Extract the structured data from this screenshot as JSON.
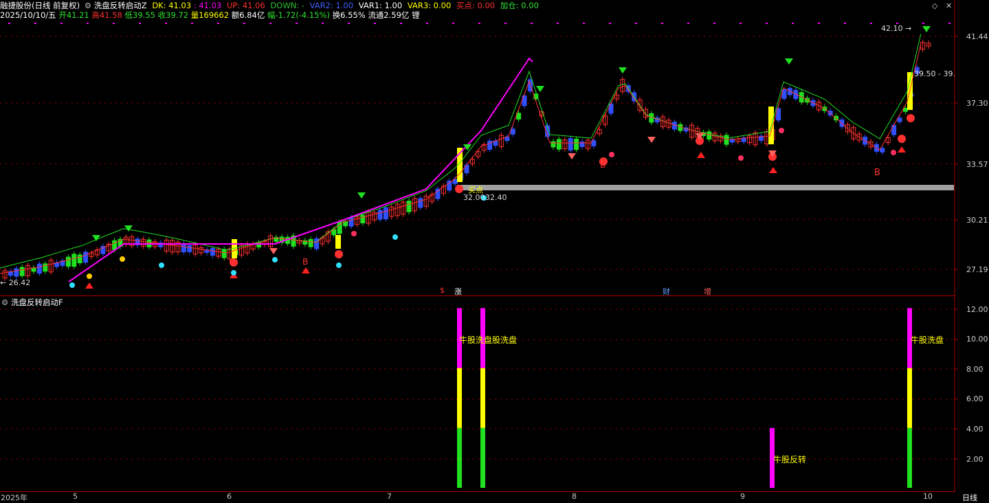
{
  "header": {
    "stock": "融捷股份(日线 前复权)",
    "indicator": "洗盘反转启动Z",
    "dk": "DK: 41.03",
    "dk2": ": 41.03",
    "up": "UP: 41.06",
    "down": "DOWN: -",
    "var2": "VAR2: 1.00",
    "var1": "VAR1: 1.00",
    "var3": "VAR3: 0.00",
    "buy": "买点: 0.00",
    "add": "加仓: 0.00"
  },
  "quote": {
    "date": "2025/10/10/五",
    "open": "开41.21",
    "high": "高41.58",
    "low": "低39.55",
    "close": "收39.72",
    "vol": "量169662",
    "amount": "额6.84亿",
    "change": "幅-1.72(-4.15%)",
    "turnover": "换6.55%",
    "float": "流通2.59亿",
    "extra": "锂"
  },
  "main_axis": {
    "ticks": [
      "41.44",
      "37.30",
      "33.57",
      "30.21",
      "27.19"
    ]
  },
  "indicator_axis": {
    "title": "洗盘反转启动F",
    "ticks": [
      "12.00",
      "10.00",
      "8.00",
      "6.00",
      "4.00",
      "2.00"
    ]
  },
  "bottom_axis": {
    "labels": [
      "2025年",
      "5",
      "6",
      "7",
      "8",
      "9",
      "10"
    ],
    "period": "日线"
  },
  "annotations": {
    "low_mark": "26.42",
    "high_mark": "42.10",
    "range_mark": "39.50 - 39.",
    "buy_label": "买点",
    "price_a": "32.00",
    "price_b": "32.40",
    "b1": "B",
    "b2": "B",
    "b3": "B",
    "ind_text1": "牛股洗盘",
    "ind_text2": "股洗盘",
    "ind_text3": "牛股反转",
    "ind_text4": "牛股洗盘",
    "event1": "$",
    "event2": "涨",
    "event3": "财",
    "event4": "增"
  },
  "colors": {
    "up": "#ff3030",
    "down": "#3050ff",
    "ma_magenta": "#ff00ff",
    "ma_green": "#20e020",
    "grid": "#a00000",
    "axis": "#b00000"
  }
}
